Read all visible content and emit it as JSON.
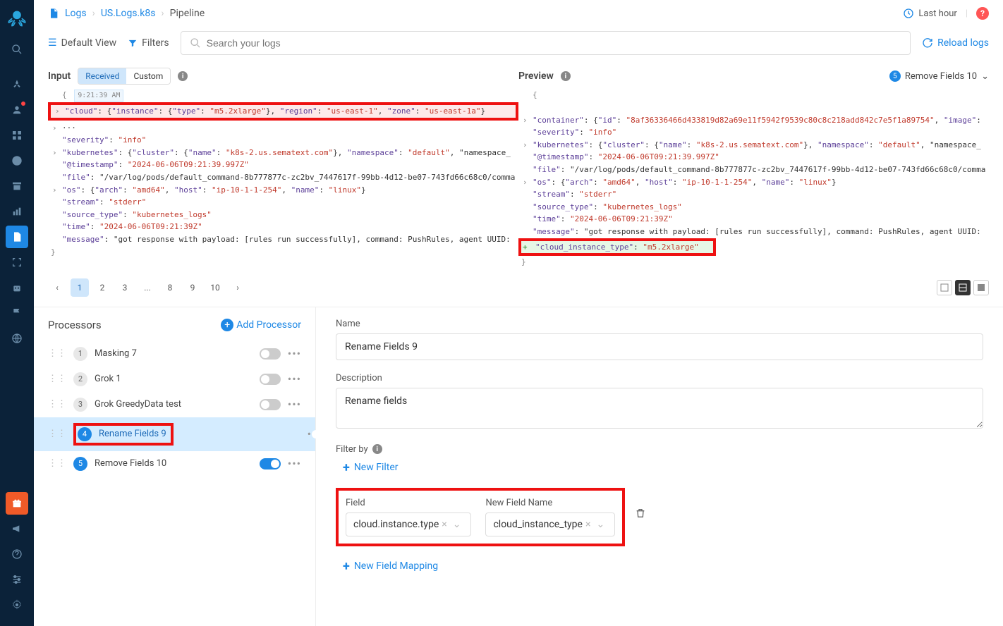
{
  "breadcrumb": {
    "icon": "file-icon",
    "items": [
      "Logs",
      "US.Logs.k8s",
      "Pipeline"
    ]
  },
  "topbar": {
    "time_range": "Last hour"
  },
  "controlbar": {
    "default_view": "Default View",
    "filters": "Filters",
    "search_placeholder": "Search your logs",
    "reload": "Reload logs"
  },
  "sections": {
    "input_title": "Input",
    "tabs": {
      "received": "Received",
      "custom": "Custom"
    },
    "preview_title": "Preview",
    "preview_pill_num": "5",
    "preview_pill_label": "Remove Fields 10"
  },
  "input_code": {
    "timestamp": "9:21:39 AM",
    "cloud_line": "\"cloud\": {\"instance\": {\"type\": \"m5.2xlarge\"}, \"region\": \"us-east-1\", \"zone\": \"us-east-1a\"}",
    "severity": "\"severity\": \"info\"",
    "kubernetes": "\"kubernetes\": {\"cluster\": {\"name\": \"k8s-2.us.sematext.com\"}, \"namespace\": \"default\", \"namespace_",
    "ts": "\"@timestamp\": \"2024-06-06T09:21:39.997Z\"",
    "file": "\"file\": \"/var/log/pods/default_command-8b777877c-zc2bv_7447617f-99bb-4d12-be07-743fd66c68c0/comma",
    "os": "\"os\": {\"arch\": \"amd64\", \"host\": \"ip-10-1-1-254\", \"name\": \"linux\"}",
    "stream": "\"stream\": \"stderr\"",
    "source_type": "\"source_type\": \"kubernetes_logs\"",
    "time": "\"time\": \"2024-06-06T09:21:39Z\"",
    "message": "\"message\": \"got response with payload: [rules run successfully], command: PushRules, agent UUID:"
  },
  "preview_code": {
    "container": "\"container\": {\"id\": \"8af36336466d433819d82a69e11f5942f9539c80c8c218add842c7e5f1a89754\", \"image\":",
    "severity": "\"severity\": \"info\"",
    "kubernetes": "\"kubernetes\": {\"cluster\": {\"name\": \"k8s-2.us.sematext.com\"}, \"namespace\": \"default\", \"namespace_",
    "ts": "\"@timestamp\": \"2024-06-06T09:21:39.997Z\"",
    "file": "\"file\": \"/var/log/pods/default_command-8b777877c-zc2bv_7447617f-99bb-4d12-be07-743fd66c68c0/comma",
    "os": "\"os\": {\"arch\": \"amd64\", \"host\": \"ip-10-1-1-254\", \"name\": \"linux\"}",
    "stream": "\"stream\": \"stderr\"",
    "source_type": "\"source_type\": \"kubernetes_logs\"",
    "time": "\"time\": \"2024-06-06T09:21:39Z\"",
    "message": "\"message\": \"got response with payload: [rules run successfully], command: PushRules, agent UUID:",
    "added": "\"cloud_instance_type\": \"m5.2xlarge\""
  },
  "pager": {
    "pages": [
      "1",
      "2",
      "3",
      "...",
      "8",
      "9",
      "10"
    ]
  },
  "processors": {
    "title": "Processors",
    "add": "Add Processor",
    "items": [
      {
        "num": "1",
        "name": "Masking 7",
        "on": false
      },
      {
        "num": "2",
        "name": "Grok 1",
        "on": false
      },
      {
        "num": "3",
        "name": "Grok GreedyData test",
        "on": false
      },
      {
        "num": "4",
        "name": "Rename Fields 9",
        "on": true,
        "active": true
      },
      {
        "num": "5",
        "name": "Remove Fields 10",
        "on": true
      }
    ]
  },
  "editor": {
    "name_label": "Name",
    "name_value": "Rename Fields 9",
    "desc_label": "Description",
    "desc_value": "Rename fields",
    "filter_label": "Filter by",
    "new_filter": "New Filter",
    "field_label": "Field",
    "new_field_label": "New Field Name",
    "field_value": "cloud.instance.type",
    "new_field_value": "cloud_instance_type",
    "new_mapping": "New Field Mapping"
  }
}
